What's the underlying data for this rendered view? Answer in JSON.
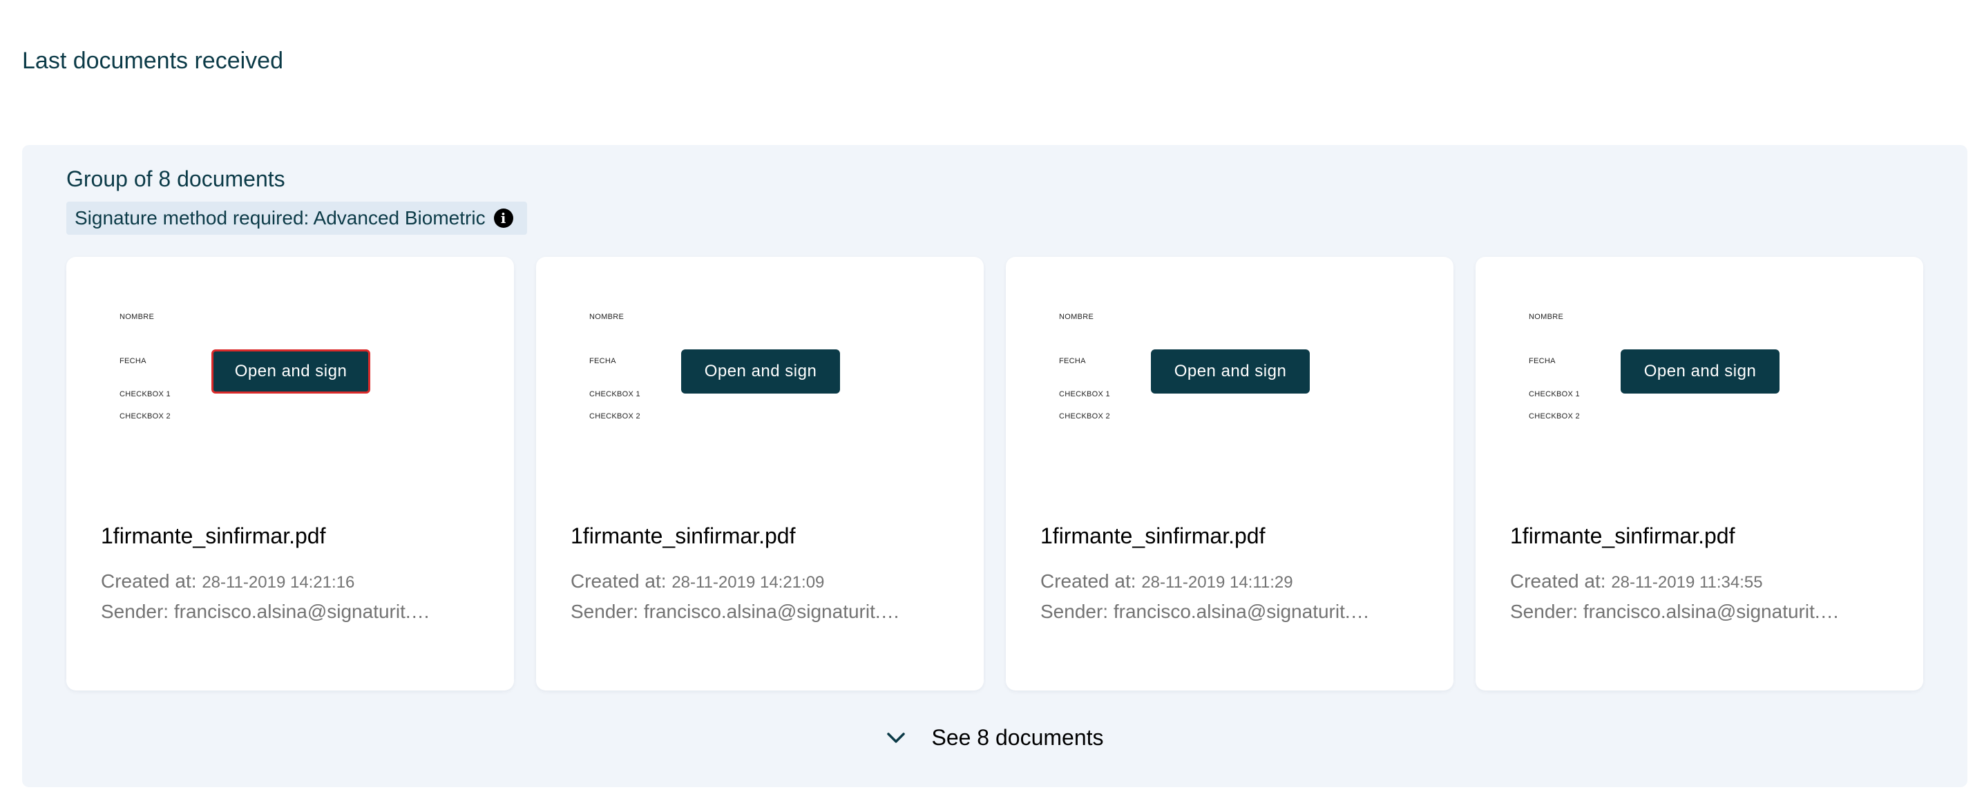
{
  "page": {
    "title": "Last documents received"
  },
  "group": {
    "title": "Group of 8 documents",
    "signature_method": "Signature method required: Advanced Biometric",
    "see_more_label": "See 8 documents",
    "documents": [
      {
        "preview_fields": [
          "NOMBRE",
          "FECHA",
          "CHECKBOX 1",
          "CHECKBOX 2"
        ],
        "action_label": "Open and sign",
        "file_name": "1firmante_sinfirmar.pdf",
        "created_label": "Created at: ",
        "created_value": "28-11-2019 14:21:16",
        "sender": "Sender: francisco.alsina@signaturit.com",
        "focused": true
      },
      {
        "preview_fields": [
          "NOMBRE",
          "FECHA",
          "CHECKBOX 1",
          "CHECKBOX 2"
        ],
        "action_label": "Open and sign",
        "file_name": "1firmante_sinfirmar.pdf",
        "created_label": "Created at: ",
        "created_value": "28-11-2019 14:21:09",
        "sender": "Sender: francisco.alsina@signaturit.com",
        "focused": false
      },
      {
        "preview_fields": [
          "NOMBRE",
          "FECHA",
          "CHECKBOX 1",
          "CHECKBOX 2"
        ],
        "action_label": "Open and sign",
        "file_name": "1firmante_sinfirmar.pdf",
        "created_label": "Created at: ",
        "created_value": "28-11-2019 14:11:29",
        "sender": "Sender: francisco.alsina@signaturit.com",
        "focused": false
      },
      {
        "preview_fields": [
          "NOMBRE",
          "FECHA",
          "CHECKBOX 1",
          "CHECKBOX 2"
        ],
        "action_label": "Open and sign",
        "file_name": "1firmante_sinfirmar.pdf",
        "created_label": "Created at: ",
        "created_value": "28-11-2019 11:34:55",
        "sender": "Sender: francisco.alsina@signaturit.com",
        "focused": false
      }
    ]
  },
  "icons": {
    "info": "info-icon",
    "expand": "chevron-down-icon"
  },
  "colors": {
    "primary": "#0b3a47",
    "panel_background": "#f1f5fa",
    "chip_background": "#dfe9f3",
    "focus_outline": "#d92a2a",
    "muted_text": "#737373"
  }
}
